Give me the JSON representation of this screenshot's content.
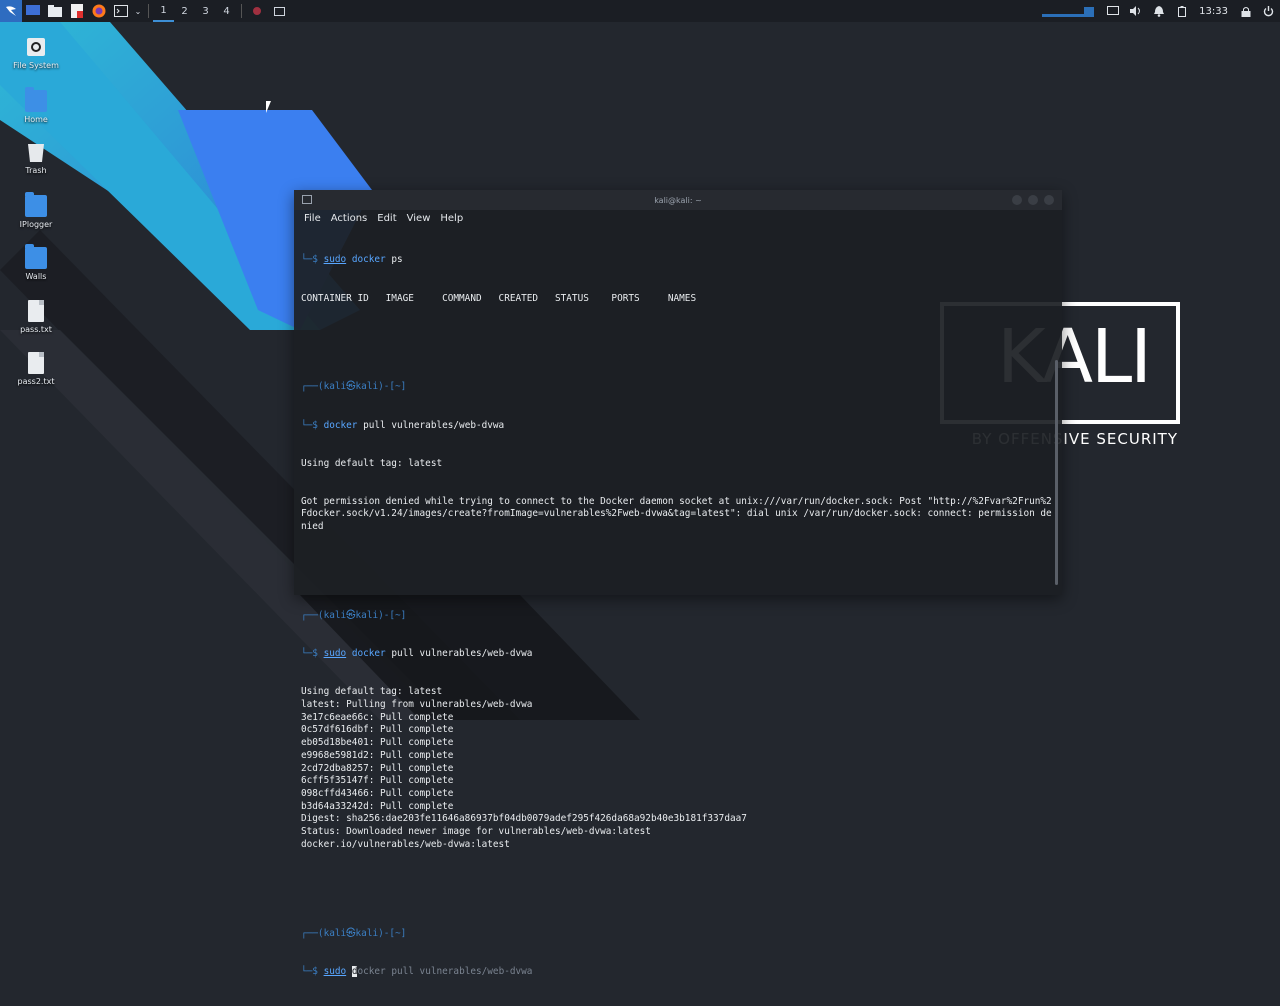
{
  "panel": {
    "workspaces": [
      "1",
      "2",
      "3",
      "4"
    ],
    "clock": "13:33",
    "icons": [
      "kali-menu-icon",
      "desktop-icon",
      "file-manager-icon",
      "text-editor-icon",
      "firefox-icon",
      "terminal-icon"
    ]
  },
  "desktop": {
    "icons": [
      {
        "label": "File System",
        "icon": "drive-icon"
      },
      {
        "label": "Home",
        "icon": "home-folder-icon"
      },
      {
        "label": "Trash",
        "icon": "trash-icon"
      },
      {
        "label": "IPlogger",
        "icon": "folder-icon"
      },
      {
        "label": "Walls",
        "icon": "folder-icon"
      },
      {
        "label": "pass.txt",
        "icon": "text-file-icon"
      },
      {
        "label": "pass2.txt",
        "icon": "text-file-icon"
      }
    ]
  },
  "terminal": {
    "title": "kali@kali: ~",
    "menu": [
      "File",
      "Actions",
      "Edit",
      "View",
      "Help"
    ],
    "ps_header": "CONTAINER ID   IMAGE     COMMAND   CREATED   STATUS    PORTS     NAMES",
    "prompt_head": "┌──(kali㉿kali)-[~]",
    "prompt_tail": "└─$ ",
    "first_prompt_tail": "└─$ ",
    "cmd1": {
      "sudo": "sudo",
      "name": "docker",
      "args": " ps"
    },
    "cmd2": {
      "name": "docker",
      "args": " pull vulnerables/web-dvwa"
    },
    "out2": [
      "Using default tag: latest",
      "Got permission denied while trying to connect to the Docker daemon socket at unix:///var/run/docker.sock: Post \"http://%2Fvar%2Frun%2Fdocker.sock/v1.24/images/create?fromImage=vulnerables%2Fweb-dvwa&tag=latest\": dial unix /var/run/docker.sock: connect: permission denied"
    ],
    "cmd3": {
      "sudo": "sudo",
      "name": "docker",
      "args": " pull vulnerables/web-dvwa"
    },
    "out3": [
      "Using default tag: latest",
      "latest: Pulling from vulnerables/web-dvwa",
      "3e17c6eae66c: Pull complete",
      "0c57df616dbf: Pull complete",
      "eb05d18be401: Pull complete",
      "e9968e5981d2: Pull complete",
      "2cd72dba8257: Pull complete",
      "6cff5f35147f: Pull complete",
      "098cffd43466: Pull complete",
      "b3d64a33242d: Pull complete",
      "Digest: sha256:dae203fe11646a86937bf04db0079adef295f426da68a92b40e3b181f337daa7",
      "Status: Downloaded newer image for vulnerables/web-dvwa:latest",
      "docker.io/vulnerables/web-dvwa:latest"
    ],
    "cmd4": {
      "sudo": "sudo",
      "cursor_char": "d",
      "ghost": "ocker pull vulnerables/web-dvwa"
    }
  },
  "logo": {
    "text": "KALI",
    "tagline": "BY OFFENSIVE SECURITY"
  },
  "colors": {
    "accent": "#3d8fe6",
    "wallpaper_cyan": "#2bb3d9",
    "wallpaper_blue": "#3b7ff0"
  }
}
